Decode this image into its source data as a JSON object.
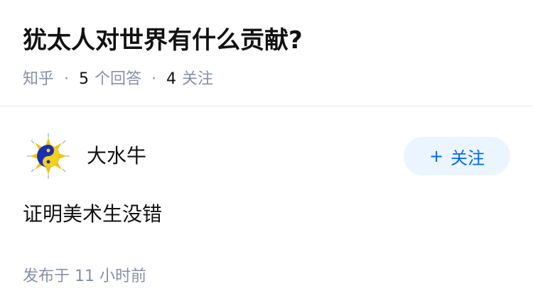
{
  "question": {
    "title": "犹太人对世界有什么贡献?",
    "source": "知乎",
    "answer_count": "5",
    "answer_label": "个回答",
    "follow_count": "4",
    "follow_label": "关注"
  },
  "answer": {
    "author_name": "大水牛",
    "follow_button": {
      "plus": "+",
      "label": "关注"
    },
    "content": "证明美术生没错",
    "time": "发布于  11 小时前"
  },
  "colors": {
    "accent": "#0066ff",
    "button_bg": "#ebf5ff",
    "meta_gray": "#8590a6",
    "divider": "#ebebeb"
  }
}
